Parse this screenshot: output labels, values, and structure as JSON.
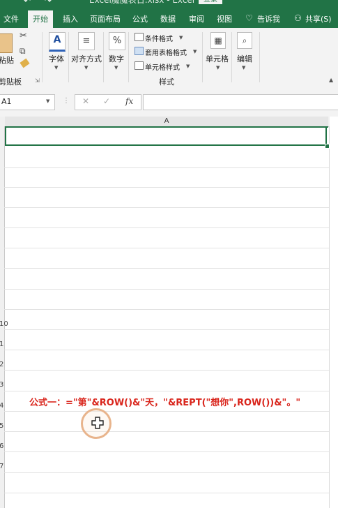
{
  "window": {
    "title": "Excel魔魔表日.xlsx - Excel",
    "signin_label": "登录"
  },
  "tabs": [
    {
      "label": "文件"
    },
    {
      "label": "开始"
    },
    {
      "label": "插入"
    },
    {
      "label": "页面布局"
    },
    {
      "label": "公式"
    },
    {
      "label": "数据"
    },
    {
      "label": "审阅"
    },
    {
      "label": "视图"
    }
  ],
  "tell_me": {
    "label": "告诉我"
  },
  "share": {
    "label": "共享(S)"
  },
  "ribbon": {
    "clipboard": {
      "paste_label": "粘贴",
      "group_label": "剪贴板"
    },
    "font": {
      "label": "字体"
    },
    "alignment": {
      "label": "对齐方式"
    },
    "number": {
      "label": "数字"
    },
    "styles": {
      "conditional_format": "条件格式",
      "format_as_table": "套用表格格式",
      "cell_styles": "单元格样式",
      "group_label": "样式"
    },
    "cells": {
      "label": "单元格"
    },
    "editing": {
      "label": "编辑"
    }
  },
  "formula_bar": {
    "name_box": "A1",
    "fx_label": "fx",
    "cancel_glyph": "✕",
    "enter_glyph": "✓",
    "content": ""
  },
  "sheet": {
    "column_header": "A",
    "row_numbers": [
      "10",
      "1",
      "2",
      "3",
      "4",
      "5",
      "6",
      "7"
    ]
  },
  "annotation": {
    "text": "公式一：=\"第\"&ROW()&\"天，\"&REPT(\"想你\",ROW())&\"。\""
  },
  "colors": {
    "excel_green": "#217346",
    "annotation_red": "#d9251c"
  }
}
